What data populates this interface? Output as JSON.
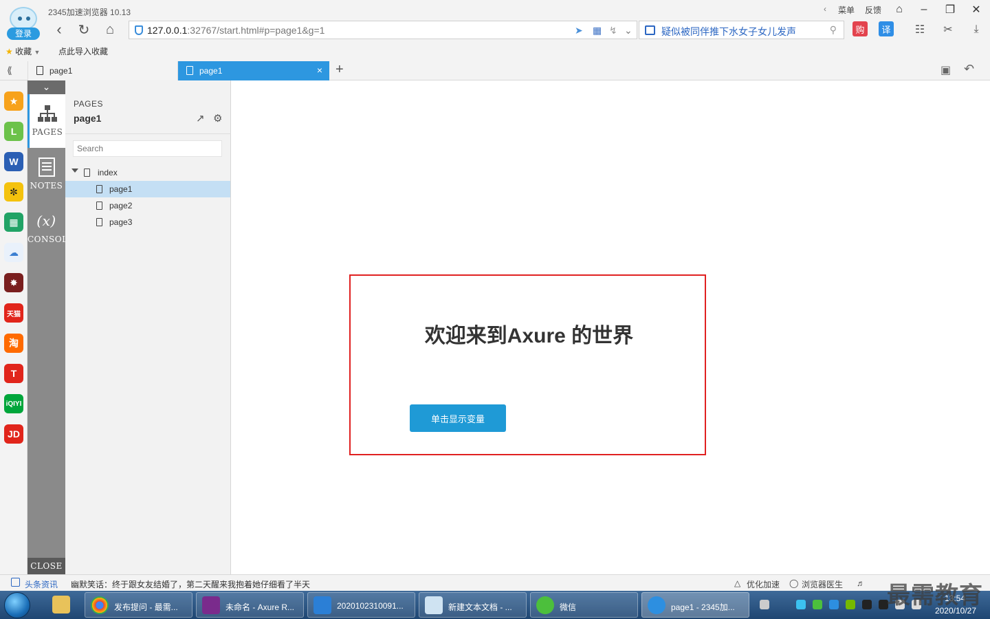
{
  "browser": {
    "app_title": "2345加速浏览器 10.13",
    "login_label": "登录",
    "address_host": "127.0.0.1",
    "address_rest": ":32767/start.html#p=page1&g=1",
    "news_search_text": "疑似被同伴推下水女子女儿发声",
    "buy_label": "购",
    "translate_label": "译",
    "menu_label": "菜单",
    "feedback_label": "反馈",
    "bookmarks_label": "收藏",
    "import_bookmarks_label": "点此导入收藏",
    "tabs": [
      {
        "label": "page1"
      },
      {
        "label": "page1"
      }
    ],
    "accent": "#2d97e0"
  },
  "axure": {
    "pane_tabs": {
      "pages": "PAGES",
      "notes": "NOTES",
      "console": "CONSOLE",
      "close": "CLOSE"
    },
    "pages_heading": "PAGES",
    "current_page": "page1",
    "search_placeholder": "Search",
    "tree": {
      "root": "index",
      "children": [
        "page1",
        "page2",
        "page3"
      ],
      "selected": "page1"
    }
  },
  "content": {
    "welcome": "欢迎来到Axure 的世界",
    "button_label": "单击显示变量",
    "frame_color": "#e02020",
    "button_color": "#1f9ad6"
  },
  "statusbar": {
    "news_label": "头条资讯",
    "news_text": "幽默笑话：终于跟女友结婚了，第二天醒来我抱着她仔细看了半天",
    "optimize_label": "优化加速",
    "doctor_label": "浏览器医生"
  },
  "taskbar": {
    "tasks": [
      {
        "label": "发布提问 - 最需..."
      },
      {
        "label": "未命名 - Axure R..."
      },
      {
        "label": "2020102310091..."
      },
      {
        "label": "新建文本文档 - ..."
      },
      {
        "label": "微信"
      },
      {
        "label": "page1 - 2345加..."
      }
    ],
    "date": "2020/10/27",
    "time": "13:54"
  },
  "watermark": "最需教育"
}
